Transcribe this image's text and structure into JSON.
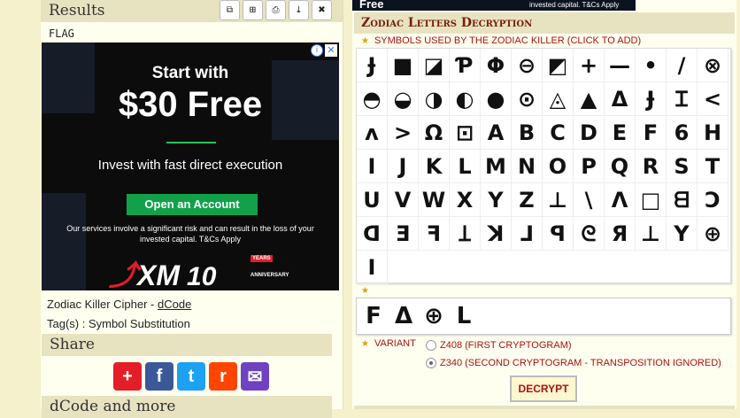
{
  "results": {
    "title": "Results",
    "tools": [
      "⧉",
      "⊞",
      "⎙",
      "⤓",
      "✖"
    ],
    "text": "FLAG"
  },
  "left_ad": {
    "headline1": "Start with",
    "headline2": "$30 Free",
    "headline3": "Invest with fast direct execution",
    "cta": "Open an Account",
    "disclaimer": "Our services involve a significant risk and can result in the loss of your invested capital. T&Cs Apply",
    "logo": "XM",
    "logo_years_num": "10",
    "logo_years": "YEARS",
    "logo_anniv": "ANNIVERSARY",
    "info": "i",
    "close": "✕"
  },
  "meta": {
    "tool_name": "Zodiac Killer Cipher - ",
    "link": "dCode",
    "tags": "Tag(s) : Symbol Substitution"
  },
  "share": {
    "title": "Share",
    "buttons": [
      {
        "name": "add",
        "glyph": "+",
        "color": "#e41e26"
      },
      {
        "name": "facebook",
        "glyph": "f",
        "color": "#3b5998"
      },
      {
        "name": "twitter",
        "glyph": "t",
        "color": "#1da1f2"
      },
      {
        "name": "reddit",
        "glyph": "r",
        "color": "#ff4500"
      },
      {
        "name": "email",
        "glyph": "✉",
        "color": "#6f42c1"
      }
    ]
  },
  "more": {
    "title": "dCode and more"
  },
  "top_ad": {
    "free": "Free",
    "legal": "invested capital. T&Cs Apply"
  },
  "tool": {
    "title": "Zodiac Letters Decryption",
    "symbols_label": "SYMBOLS USED BY THE ZODIAC KILLER (CLICK TO ADD)",
    "symbols": [
      "Ɉ",
      "■",
      "◪",
      "Ƥ",
      "Φ",
      "⊖",
      "◩",
      "+",
      "—",
      "•",
      "/",
      "⊗",
      "◓",
      "◒",
      "◑",
      "◐",
      "●",
      "⊙",
      "◬",
      "▲",
      "Δ",
      "Ɉ",
      "Ɪ",
      "<",
      "ʌ",
      ">",
      "Ω",
      "⊡",
      "A",
      "B",
      "C",
      "D",
      "E",
      "F",
      "6",
      "H",
      "I",
      "J",
      "K",
      "L",
      "M",
      "N",
      "O",
      "P",
      "Q",
      "R",
      "S",
      "T",
      "U",
      "V",
      "W",
      "X",
      "Y",
      "Z",
      "⊥",
      "\\",
      "Λ",
      "□",
      "ᗺ",
      "Ↄ",
      "ᗡ",
      "Ǝ",
      "ꟻ",
      "Ʇ",
      "ꓘ",
      "⅃",
      "ꟼ",
      "ᘓ",
      "Я",
      "⊥",
      "Y",
      "⊕",
      "I"
    ],
    "input_label": "★",
    "input_symbols": [
      "F",
      "Δ",
      "⊕",
      "L"
    ],
    "variant_label": "VARIANT",
    "variant_options": [
      {
        "label": "Z408 (FIRST CRYPTOGRAM)",
        "selected": false
      },
      {
        "label": "Z340 (SECOND CRYPTOGRAM - TRANSPOSITION IGNORED)",
        "selected": true
      }
    ],
    "decrypt_label": "DECRYPT"
  }
}
